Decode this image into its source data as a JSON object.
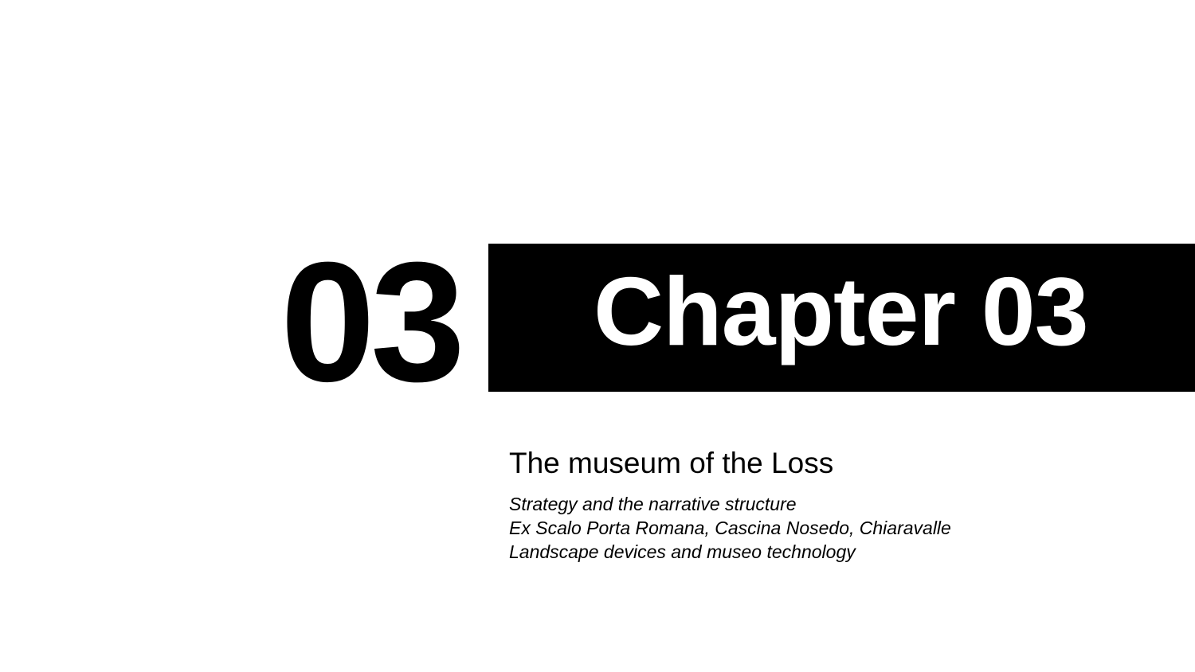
{
  "chapter": {
    "number": "03",
    "title": "Chapter 03"
  },
  "section": {
    "heading": "The museum of the Loss",
    "subtitles": [
      "Strategy and the narrative structure",
      "Ex Scalo Porta Romana, Cascina Nosedo, Chiaravalle",
      "Landscape devices and museo technology"
    ]
  },
  "colors": {
    "band": "#000000",
    "band_text": "#ffffff",
    "text": "#000000",
    "background": "#ffffff"
  }
}
